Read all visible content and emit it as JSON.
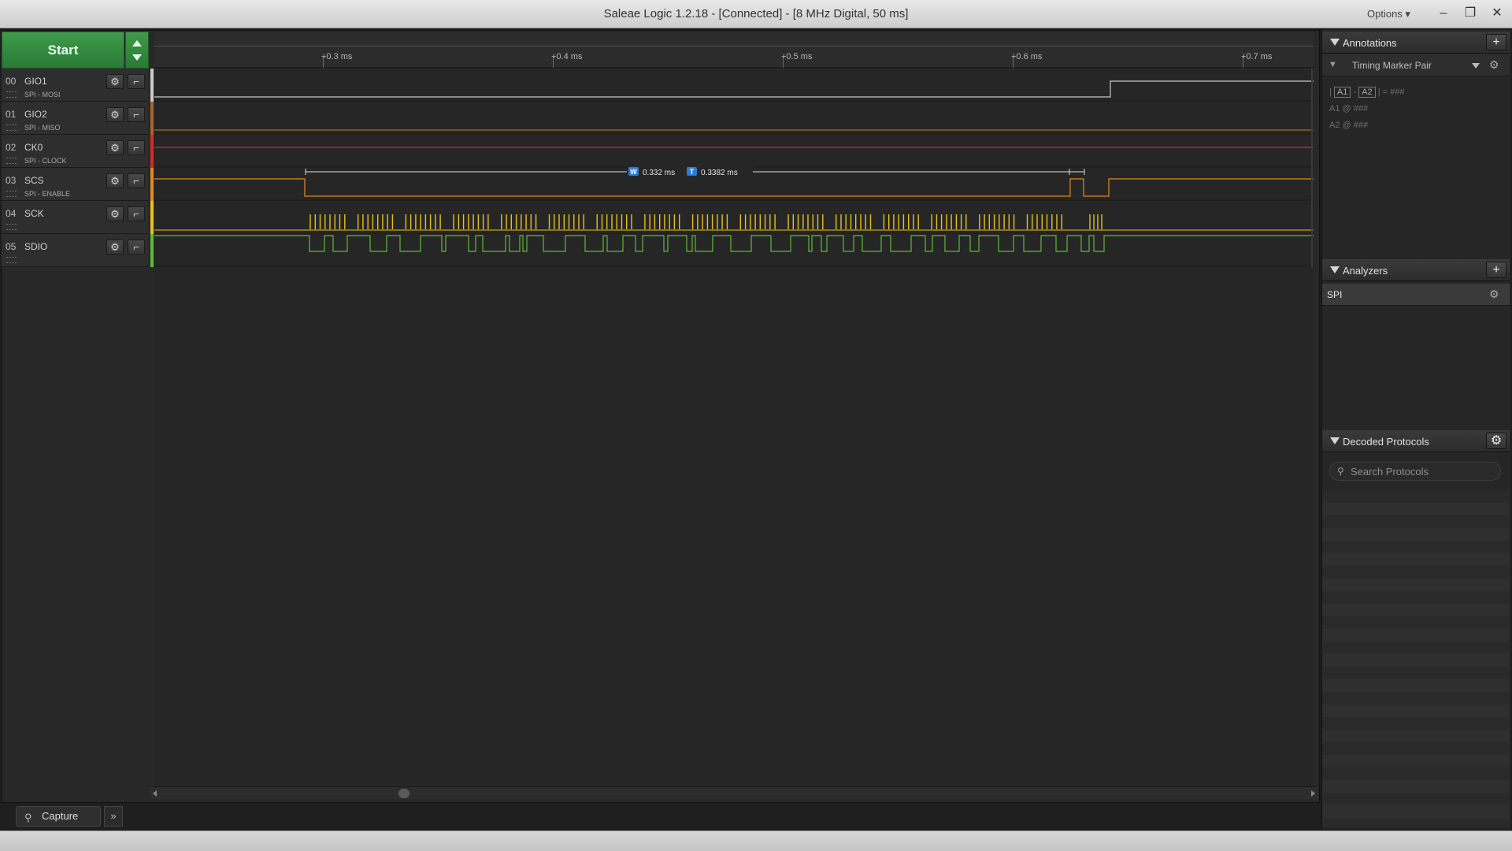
{
  "window": {
    "title": "Saleae Logic 1.2.18 - [Connected] - [8 MHz Digital, 50 ms]",
    "options_label": "Options ▾",
    "minimize": "–",
    "restore": "❐",
    "close": "✕"
  },
  "capture": {
    "start_label": "Start"
  },
  "channels": [
    {
      "num": "00",
      "name": "GIO1",
      "sub": "SPI - MOSI",
      "color": "#c9c9c9"
    },
    {
      "num": "01",
      "name": "GIO2",
      "sub": "SPI - MISO",
      "color": "#a8652a"
    },
    {
      "num": "02",
      "name": "CK0",
      "sub": "SPI - CLOCK",
      "color": "#d6282a"
    },
    {
      "num": "03",
      "name": "SCS",
      "sub": "SPI - ENABLE",
      "color": "#e08a1f"
    },
    {
      "num": "04",
      "name": "SCK",
      "sub": "",
      "color": "#e6c21e"
    },
    {
      "num": "05",
      "name": "SDIO",
      "sub": "",
      "color": "#5bbb35"
    }
  ],
  "ruler": {
    "ticks": [
      "+0.3 ms",
      "+0.4 ms",
      "+0.5 ms",
      "+0.6 ms",
      "+0.7 ms"
    ]
  },
  "measurement": {
    "width_badge": "W",
    "width_value": "0.332 ms",
    "period_badge": "T",
    "period_value": "0.3382 ms"
  },
  "bottom_tabs": {
    "capture_label": "Capture",
    "more_label": "»"
  },
  "annotations": {
    "title": "Annotations",
    "add_label": "+",
    "marker_pair_label": "Timing Marker Pair",
    "marker_a1": "A1",
    "marker_a2": "A2",
    "diff_prefix": "|",
    "diff_sep": "-",
    "diff_suffix": "| = ###",
    "a1_value": "A1  @  ###",
    "a2_value": "A2  @  ###"
  },
  "analyzers": {
    "title": "Analyzers",
    "add_label": "+",
    "items": [
      {
        "label": "SPI"
      }
    ]
  },
  "decoded": {
    "title": "Decoded Protocols",
    "search_placeholder": "Search Protocols"
  },
  "colors": {
    "start_green": "#2f8a3c",
    "gio1": "#c9c9c9",
    "gio2": "#a8652a",
    "ck0": "#d6282a",
    "scs": "#e08a1f",
    "sck": "#e6c21e",
    "sdio": "#5bbb35",
    "badge_blue": "#2b7bd6"
  }
}
